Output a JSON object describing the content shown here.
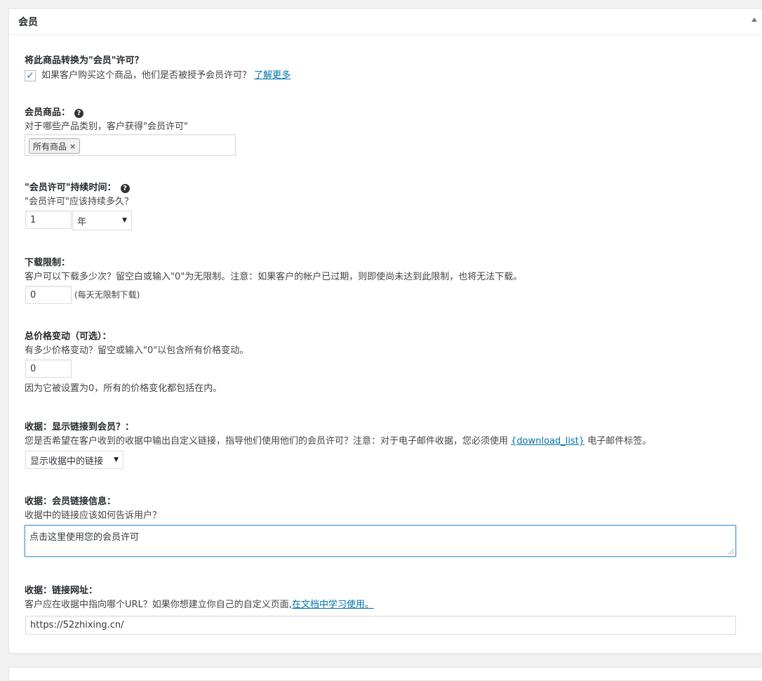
{
  "metabox": {
    "title": "会员"
  },
  "convert": {
    "label": "将此商品转换为\"会员\"许可？",
    "checkbox_checked": true,
    "checkbox_text": "如果客户购买这个商品，他们是否被授予会员许可？",
    "learn_more": "了解更多"
  },
  "member_products": {
    "label": "会员商品：",
    "help_icon": "question-icon",
    "desc": "对于哪些产品类别，客户获得\"会员许可\"",
    "token": "所有商品",
    "token_remove": "×"
  },
  "duration": {
    "label": "\"会员许可\"持续时间：",
    "help_icon": "question-icon",
    "desc": "\"会员许可\"应该持续多久？",
    "value": "1",
    "unit": "年"
  },
  "download_limit": {
    "label": "下载限制：",
    "desc": "客户可以下载多少次？留空白或输入\"0\"为无限制。注意：如果客户的帐户已过期，则即使尚未达到此限制，也将无法下载。",
    "value": "0",
    "note": "(每天无限制下载)"
  },
  "price_changes": {
    "label": "总价格变动（可选）：",
    "desc": "有多少价格变动？留空或输入\"0\"以包含所有价格变动。",
    "value": "0",
    "note": "因为它被设置为0，所有的价格变化都包括在内。"
  },
  "receipt_show": {
    "label": "收据：显示链接到会员？：",
    "desc_before": "您是否希望在客户收到的收据中输出自定义链接，指导他们使用他们的会员许可？注意：对于电子邮件收据，您必须使用 ",
    "desc_link": "{download_list}",
    "desc_after": " 电子邮件标签。",
    "selected": "显示收据中的链接"
  },
  "receipt_info": {
    "label": "收据：会员链接信息：",
    "desc": "收据中的链接应该如何告诉用户？",
    "value": "点击这里使用您的会员许可"
  },
  "receipt_url": {
    "label": "收据：链接网址：",
    "desc_before": "客户应在收据中指向哪个URL？如果你想建立你自己的自定义页面,",
    "desc_link": "在文档中学习使用。",
    "value": "https://52zhixing.cn/"
  }
}
